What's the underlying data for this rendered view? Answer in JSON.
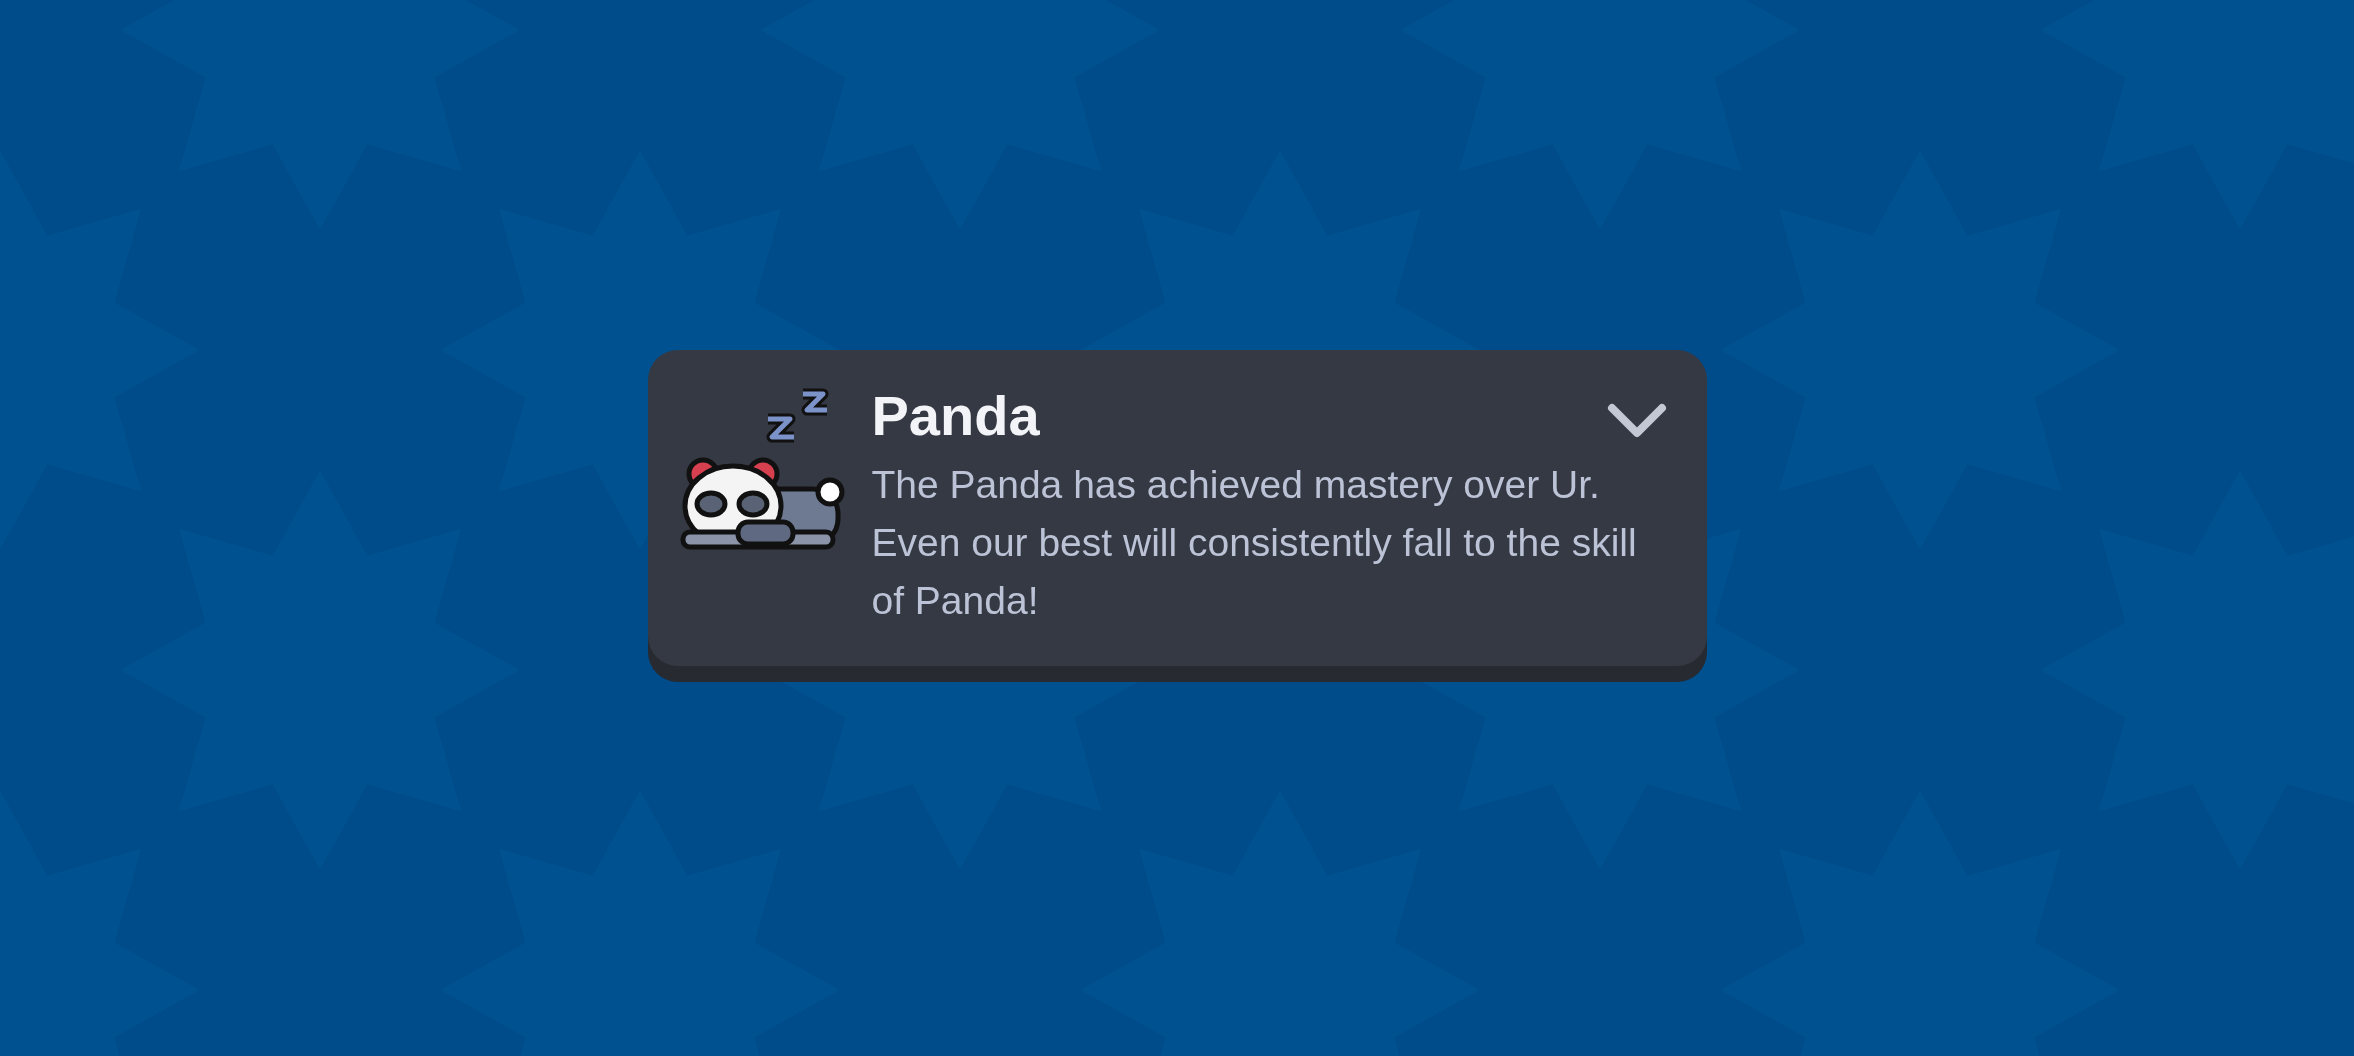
{
  "notification": {
    "title": "Panda",
    "message": "The Panda has achieved mastery over Ur. Even our best will consistently fall to the skill of Panda!"
  }
}
